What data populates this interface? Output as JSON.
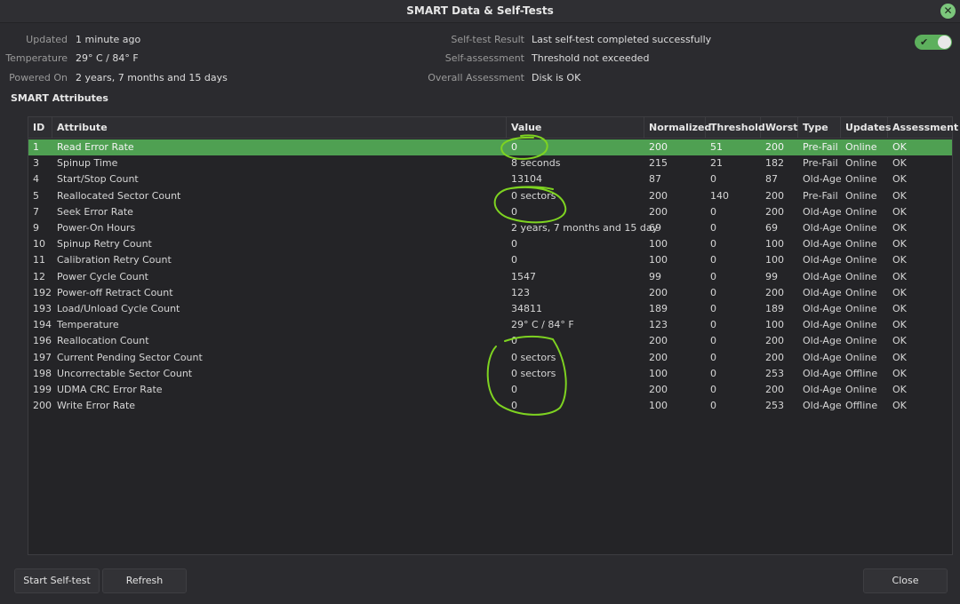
{
  "window": {
    "title": "SMART Data & Self-Tests"
  },
  "info_left": [
    {
      "label": "Updated",
      "value": "1 minute ago"
    },
    {
      "label": "Temperature",
      "value": "29° C / 84° F"
    },
    {
      "label": "Powered On",
      "value": "2 years, 7 months and 15 days"
    }
  ],
  "info_right": [
    {
      "label": "Self-test Result",
      "value": "Last self-test completed successfully"
    },
    {
      "label": "Self-assessment",
      "value": "Threshold not exceeded"
    },
    {
      "label": "Overall Assessment",
      "value": "Disk is OK"
    }
  ],
  "toggle": {
    "state": "on",
    "icon": "check-icon",
    "color": "#5db05d"
  },
  "section_title": "SMART Attributes",
  "table": {
    "columns": [
      "ID",
      "Attribute",
      "Value",
      "Normalized",
      "Threshold",
      "Worst",
      "Type",
      "Updates",
      "Assessment"
    ],
    "selected_row": 0,
    "rows": [
      [
        "1",
        "Read Error Rate",
        "0",
        "200",
        "51",
        "200",
        "Pre-Fail",
        "Online",
        "OK"
      ],
      [
        "3",
        "Spinup Time",
        "8 seconds",
        "215",
        "21",
        "182",
        "Pre-Fail",
        "Online",
        "OK"
      ],
      [
        "4",
        "Start/Stop Count",
        "13104",
        "87",
        "0",
        "87",
        "Old-Age",
        "Online",
        "OK"
      ],
      [
        "5",
        "Reallocated Sector Count",
        "0 sectors",
        "200",
        "140",
        "200",
        "Pre-Fail",
        "Online",
        "OK"
      ],
      [
        "7",
        "Seek Error Rate",
        "0",
        "200",
        "0",
        "200",
        "Old-Age",
        "Online",
        "OK"
      ],
      [
        "9",
        "Power-On Hours",
        "2 years, 7 months and 15 days",
        "69",
        "0",
        "69",
        "Old-Age",
        "Online",
        "OK"
      ],
      [
        "10",
        "Spinup Retry Count",
        "0",
        "100",
        "0",
        "100",
        "Old-Age",
        "Online",
        "OK"
      ],
      [
        "11",
        "Calibration Retry Count",
        "0",
        "100",
        "0",
        "100",
        "Old-Age",
        "Online",
        "OK"
      ],
      [
        "12",
        "Power Cycle Count",
        "1547",
        "99",
        "0",
        "99",
        "Old-Age",
        "Online",
        "OK"
      ],
      [
        "192",
        "Power-off Retract Count",
        "123",
        "200",
        "0",
        "200",
        "Old-Age",
        "Online",
        "OK"
      ],
      [
        "193",
        "Load/Unload Cycle Count",
        "34811",
        "189",
        "0",
        "189",
        "Old-Age",
        "Online",
        "OK"
      ],
      [
        "194",
        "Temperature",
        "29° C / 84° F",
        "123",
        "0",
        "100",
        "Old-Age",
        "Online",
        "OK"
      ],
      [
        "196",
        "Reallocation Count",
        "0",
        "200",
        "0",
        "200",
        "Old-Age",
        "Online",
        "OK"
      ],
      [
        "197",
        "Current Pending Sector Count",
        "0 sectors",
        "200",
        "0",
        "200",
        "Old-Age",
        "Online",
        "OK"
      ],
      [
        "198",
        "Uncorrectable Sector Count",
        "0 sectors",
        "100",
        "0",
        "253",
        "Old-Age",
        "Offline",
        "OK"
      ],
      [
        "199",
        "UDMA CRC Error Rate",
        "0",
        "200",
        "0",
        "200",
        "Old-Age",
        "Online",
        "OK"
      ],
      [
        "200",
        "Write Error Rate",
        "0",
        "100",
        "0",
        "253",
        "Old-Age",
        "Offline",
        "OK"
      ]
    ]
  },
  "buttons": {
    "start_selftest": "Start Self-test",
    "refresh": "Refresh",
    "close": "Close"
  },
  "colors": {
    "accent": "#4fa052",
    "annotation": "#7ed321"
  }
}
